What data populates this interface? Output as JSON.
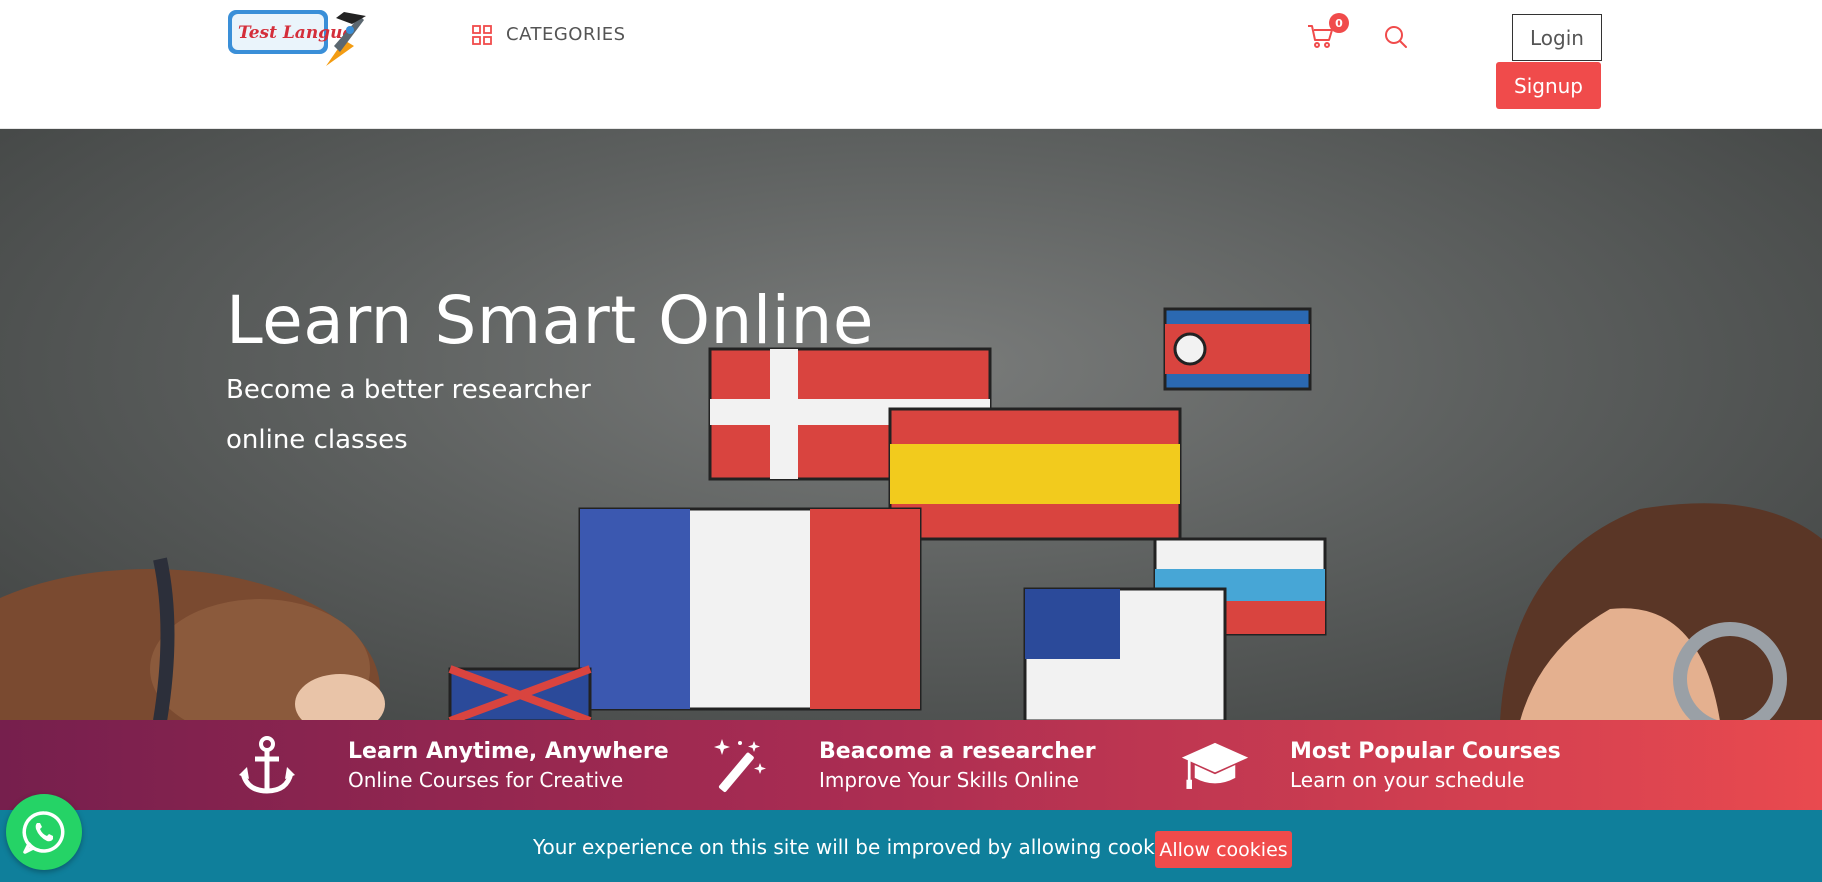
{
  "header": {
    "logo_text": "Test Langue",
    "categories_label": "CATEGORIES",
    "cart_count": "0",
    "login_label": "Login",
    "signup_label": "Signup"
  },
  "hero": {
    "title": "Learn Smart Online",
    "subtitle_line1": "Become a better researcher",
    "subtitle_line2": "online classes"
  },
  "features": [
    {
      "icon": "anchor-icon",
      "title": "Learn Anytime, Anywhere",
      "subtitle": "Online Courses for Creative"
    },
    {
      "icon": "magic-wand-icon",
      "title": "Beacome a researcher",
      "subtitle": "Improve Your Skills Online"
    },
    {
      "icon": "graduation-cap-icon",
      "title": "Most Popular Courses",
      "subtitle": "Learn on your schedule"
    }
  ],
  "cookie": {
    "message": "Your experience on this site will be improved by allowing cookies.",
    "button_label": "Allow cookies"
  },
  "colors": {
    "accent": "#f04b4b",
    "cookie_bar": "#0f7f9b",
    "features_start": "#761f4d",
    "features_end": "#e94a4f",
    "whatsapp": "#25d366"
  }
}
